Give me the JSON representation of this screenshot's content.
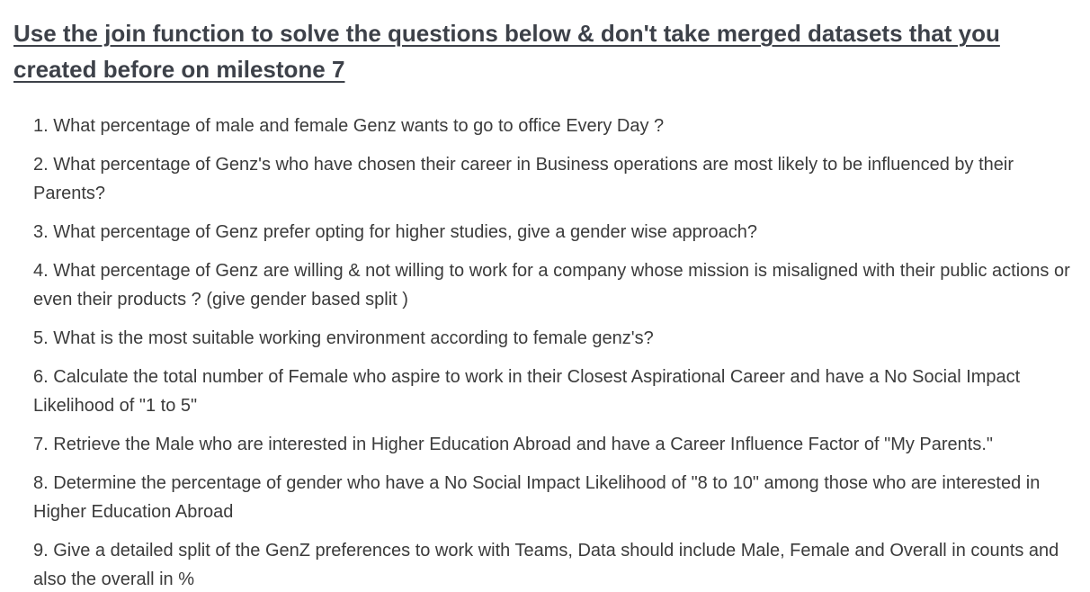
{
  "heading": "Use the join function to solve the questions below & don't take merged datasets that you created before on milestone 7",
  "questions": [
    {
      "num": "1.",
      "text": "What percentage of male and female Genz wants to go to office Every Day ?"
    },
    {
      "num": "2.",
      "text": "What percentage of Genz's who have chosen their career in Business operations are most likely to be influenced by their Parents?"
    },
    {
      "num": "3.",
      "text": "What percentage of Genz prefer opting for higher studies, give a gender wise approach?"
    },
    {
      "num": "4.",
      "text": "What percentage of Genz are willing & not willing to work for a company whose mission is misaligned with their public actions or even their products ? (give gender based split )"
    },
    {
      "num": "5.",
      "text": "What is the most suitable working environment according to female genz's?"
    },
    {
      "num": "6.",
      "text": "Calculate the total number of Female who aspire to work in their Closest Aspirational Career and have a No Social Impact Likelihood of \"1 to 5\""
    },
    {
      "num": "7.",
      "text": "Retrieve the Male who are interested in Higher Education Abroad and have a Career Influence Factor of \"My Parents.\""
    },
    {
      "num": "8.",
      "text": "Determine the percentage of gender who have a No Social Impact Likelihood of \"8 to 10\" among those who are interested in Higher Education Abroad"
    },
    {
      "num": "9.",
      "text": "Give a detailed split of the GenZ preferences to work with Teams, Data should include Male, Female and Overall in counts and also the overall in %"
    }
  ]
}
